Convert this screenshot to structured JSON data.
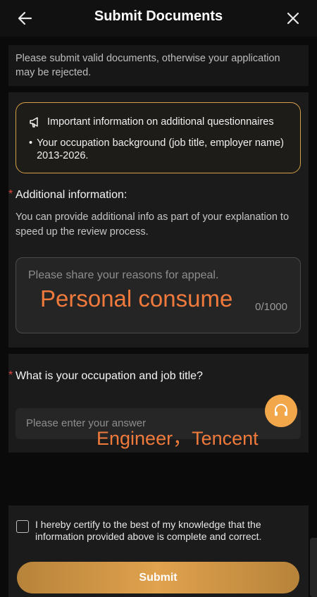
{
  "header": {
    "title": "Submit Documents",
    "back_icon": "arrow-left-icon",
    "close_icon": "close-icon"
  },
  "intro": {
    "text": "Please submit valid documents, otherwise your application may be rejected."
  },
  "notice": {
    "icon": "megaphone-icon",
    "title": "Important information on additional questionnaires",
    "bullet": "Your occupation background (job title, employer name) 2013-2026."
  },
  "additional_info": {
    "required_mark": "*",
    "label": "Additional information:",
    "help": "You can provide additional info as part of your explanation to speed up the review process.",
    "placeholder": "Please share your reasons for appeal.",
    "value": "Personal consume",
    "counter": "0/1000"
  },
  "occupation": {
    "required_mark": "*",
    "label": "What is your occupation and job title?",
    "placeholder": "Please enter your answer",
    "value": "Engineer，Tencent"
  },
  "support": {
    "icon": "headset-icon"
  },
  "footer": {
    "certify_text": "I hereby certify to the best of my knowledge that the information provided above is complete and correct.",
    "submit_label": "Submit"
  },
  "colors": {
    "accent": "#f2a74b",
    "notice_border": "#d4a047",
    "handwritten_overlay": "#f07a3c",
    "required": "#e0433c"
  }
}
